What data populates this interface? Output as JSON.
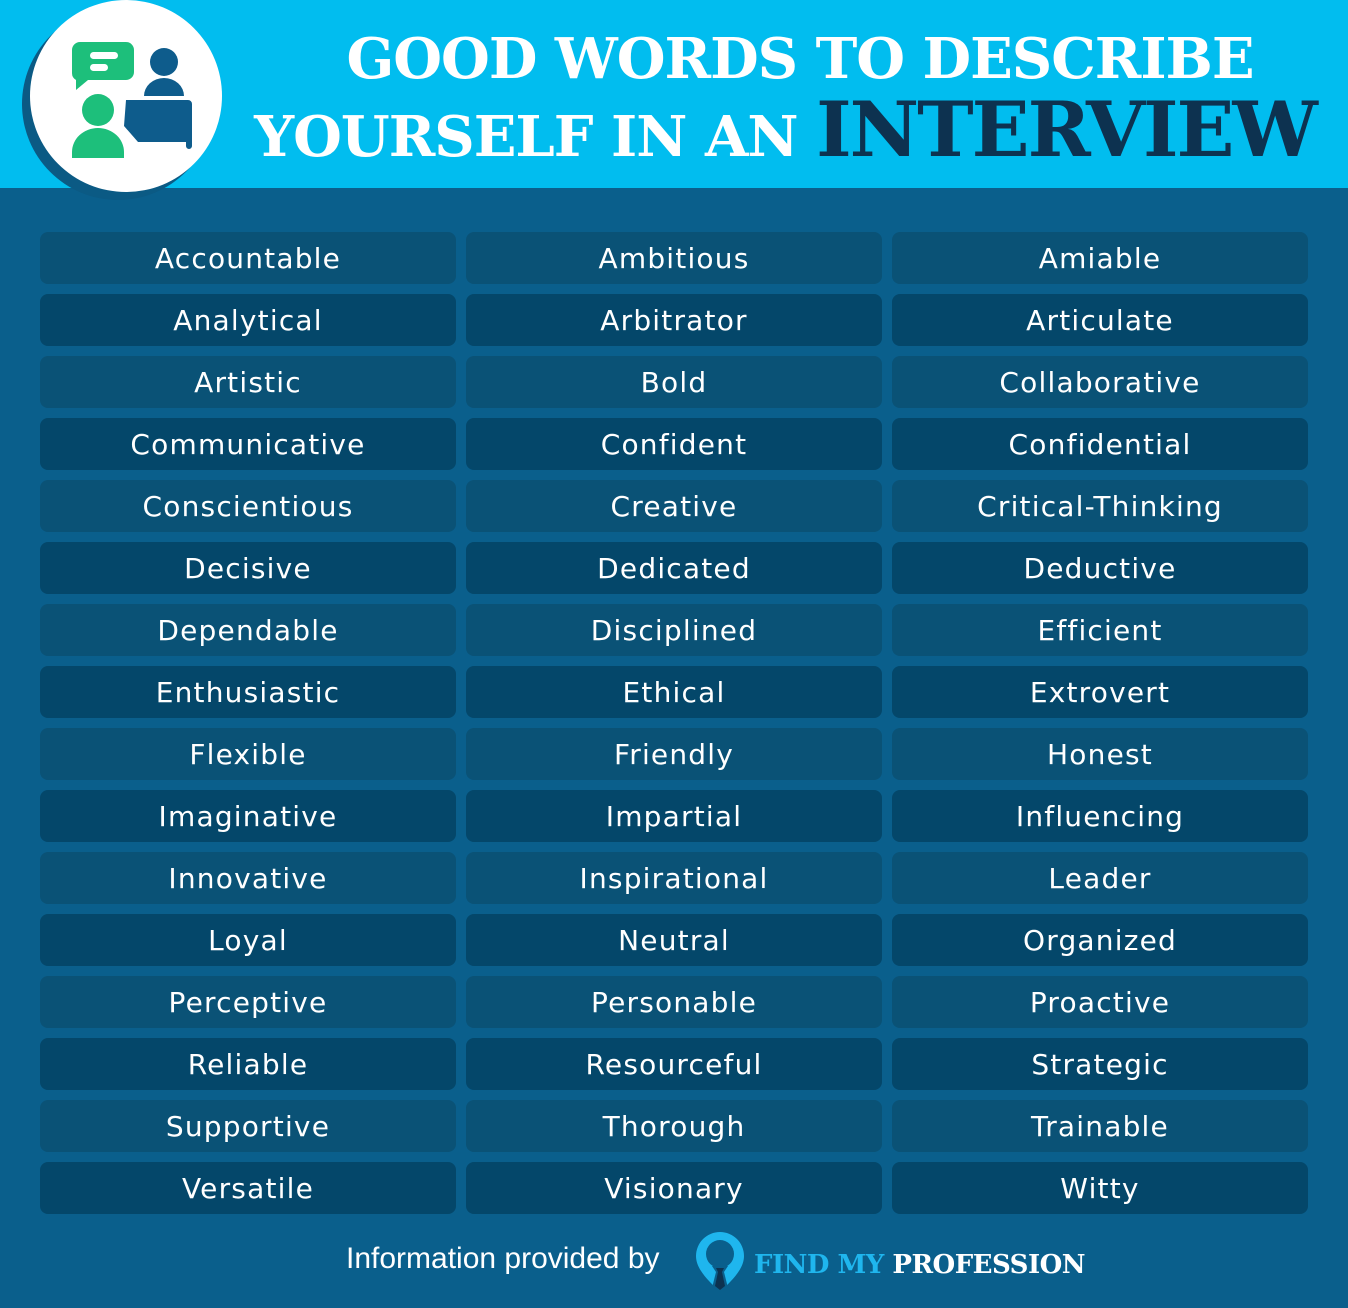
{
  "header": {
    "title_line1": "GOOD WORDS TO DESCRIBE",
    "title_line2_prefix": "YOURSELF IN AN",
    "title_emphasis": "INTERVIEW",
    "icon": "interview-people-chat-icon"
  },
  "colors": {
    "header_bg": "#01bdef",
    "body_bg": "#0a5f8c",
    "cell_light": "#0a5276",
    "cell_dark": "#04476a",
    "title_emphasis": "#0d3250",
    "accent_green": "#1dbf7b",
    "icon_blue": "#0e5c8c"
  },
  "words": [
    [
      "Accountable",
      "Ambitious",
      "Amiable"
    ],
    [
      "Analytical",
      "Arbitrator",
      "Articulate"
    ],
    [
      "Artistic",
      "Bold",
      "Collaborative"
    ],
    [
      "Communicative",
      "Confident",
      "Confidential"
    ],
    [
      "Conscientious",
      "Creative",
      "Critical-Thinking"
    ],
    [
      "Decisive",
      "Dedicated",
      "Deductive"
    ],
    [
      "Dependable",
      "Disciplined",
      "Efficient"
    ],
    [
      "Enthusiastic",
      "Ethical",
      "Extrovert"
    ],
    [
      "Flexible",
      "Friendly",
      "Honest"
    ],
    [
      "Imaginative",
      "Impartial",
      "Influencing"
    ],
    [
      "Innovative",
      "Inspirational",
      "Leader"
    ],
    [
      "Loyal",
      "Neutral",
      "Organized"
    ],
    [
      "Perceptive",
      "Personable",
      "Proactive"
    ],
    [
      "Reliable",
      "Resourceful",
      "Strategic"
    ],
    [
      "Supportive",
      "Thorough",
      "Trainable"
    ],
    [
      "Versatile",
      "Visionary",
      "Witty"
    ]
  ],
  "footer": {
    "text": "Information provided by",
    "logo_part1": "FIND MY",
    "logo_part2": "PROFESSION",
    "logo_icon": "location-pin-tie-icon"
  }
}
